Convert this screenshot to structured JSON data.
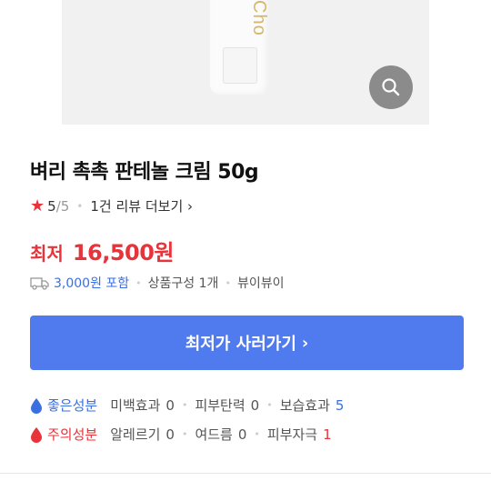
{
  "product_image": {
    "brand_text": "Cho"
  },
  "title": "벼리 촉촉 판테놀 크림 50g",
  "rating": {
    "score": "5",
    "max": "/5",
    "reviews": "1건 리뷰 더보기"
  },
  "price": {
    "label": "최저",
    "value": "16,500원"
  },
  "shipping": {
    "fee": "3,000원 포함",
    "composition": "상품구성 1개",
    "seller": "뷰이뷰이"
  },
  "buy_button": {
    "label": "최저가 사러가기"
  },
  "good_ingredients": {
    "heading": "좋은성분",
    "items": [
      {
        "name": "미백효과",
        "count": "0"
      },
      {
        "name": "피부탄력",
        "count": "0"
      },
      {
        "name": "보습효과",
        "count": "5"
      }
    ]
  },
  "caution_ingredients": {
    "heading": "주의성분",
    "items": [
      {
        "name": "알레르기",
        "count": "0"
      },
      {
        "name": "여드름",
        "count": "0"
      },
      {
        "name": "피부자극",
        "count": "1"
      }
    ]
  },
  "colors": {
    "accent_red": "#e8333a",
    "accent_blue": "#3b6fe0",
    "button_blue": "#4f7bef"
  }
}
